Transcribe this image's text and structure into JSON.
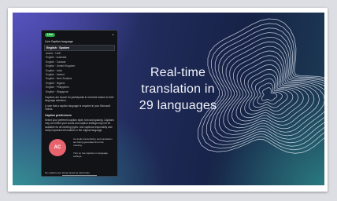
{
  "slide": {
    "headline": [
      "Real-time",
      "translation in",
      "29 languages"
    ]
  },
  "phone": {
    "status_pill": "Live",
    "close_glyph": "×",
    "panel_title": "Live Caption language",
    "selected_language": "English · Spoken",
    "languages": [
      "Arabic · UAE",
      "English · Australia",
      "English · Canada",
      "English · United Kingdom",
      "English · India",
      "English · Ireland",
      "English · New Zealand",
      "English · Nigeria",
      "English · Philippines",
      "English · Singapore"
    ],
    "note_1": "Captions are shown for participants in real time based on their language selection.",
    "note_2": "A note that a caption language is required in your Microsoft Teams.",
    "section_heading": "Caption preferences",
    "note_3": "Select your preferred caption style, font and spacing. Captions may not reflect your words and caption settings may not be available for all meeting types. Use captions responsibly and verify important information in the original language.",
    "avatar_initials": "AC",
    "side_text_1": "An audio transcription and translation are being generated from the meeting.",
    "side_text_2": "Turn on live captions in language settings.",
    "footer_text": "No captions are being saved as transcripts."
  },
  "colors": {
    "pill": "#27a845",
    "avatar": "#e8636e",
    "slide_dark": "#162246",
    "accent_purple": "#5a54c4",
    "accent_teal": "#349c96"
  }
}
